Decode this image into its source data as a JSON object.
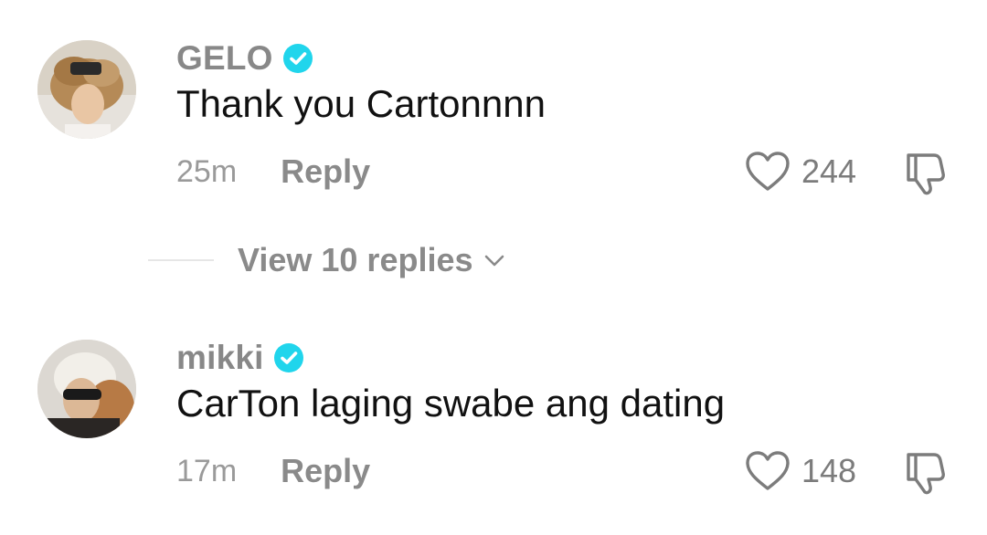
{
  "comments": [
    {
      "username": "GELO",
      "verified": true,
      "text": "Thank you Cartonnnn",
      "time": "25m",
      "reply_label": "Reply",
      "likes": "244"
    },
    {
      "username": "mikki",
      "verified": true,
      "text": "CarTon laging swabe ang dating",
      "time": "17m",
      "reply_label": "Reply",
      "likes": "148"
    }
  ],
  "view_replies": {
    "label": "View 10 replies"
  },
  "colors": {
    "verified_badge": "#20D5EC",
    "username": "#888888",
    "text": "#111111",
    "meta": "#9a9a9a"
  },
  "icons": {
    "like": "heart-outline-icon",
    "dislike": "thumbs-down-icon",
    "verified": "verified-check-icon",
    "expand": "chevron-down-icon"
  }
}
